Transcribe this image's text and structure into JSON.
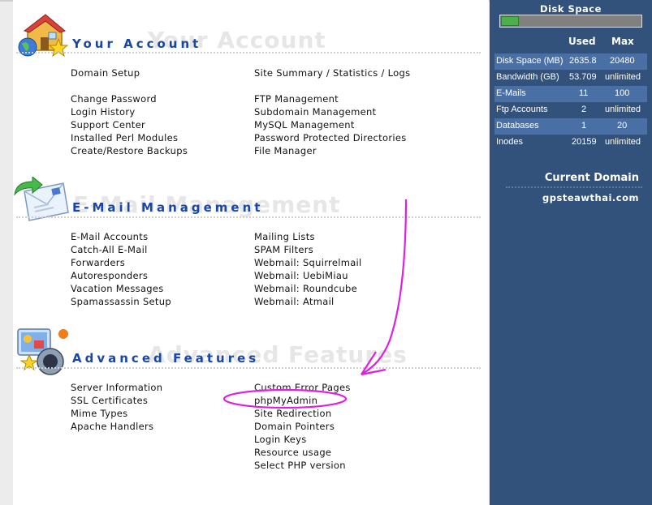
{
  "sections": {
    "account": {
      "title": "Your Account",
      "ghost": "Your Account",
      "left": [
        "Domain Setup",
        "Change Password",
        "Login History",
        "Support Center",
        "Installed Perl Modules",
        "Create/Restore Backups"
      ],
      "right": [
        "Site Summary / Statistics / Logs",
        "FTP Management",
        "Subdomain Management",
        "MySQL Management",
        "Password Protected Directories",
        "File Manager"
      ]
    },
    "email": {
      "title": "E-Mail Management",
      "ghost": "E-Mail Management",
      "left": [
        "E-Mail Accounts",
        "Catch-All E-Mail",
        "Forwarders",
        "Autoresponders",
        "Vacation Messages",
        "Spamassassin Setup"
      ],
      "right": [
        "Mailing Lists",
        "SPAM Filters",
        "Webmail: Squirrelmail",
        "Webmail: UebiMiau",
        "Webmail: Roundcube",
        "Webmail: Atmail"
      ]
    },
    "advanced": {
      "title": "Advanced Features",
      "ghost": "Advanced Features",
      "left": [
        "Server Information",
        "SSL Certificates",
        "Mime Types",
        "Apache Handlers"
      ],
      "right": [
        "Custom Error Pages",
        "phpMyAdmin",
        "Site Redirection",
        "Domain Pointers",
        "Login Keys",
        "Resource usage",
        "Select PHP version"
      ]
    }
  },
  "sidebar": {
    "disk_title": "Disk Space",
    "disk_fraction": 0.129,
    "col_used": "Used",
    "col_max": "Max",
    "rows": [
      {
        "label": "Disk Space (MB)",
        "used": "2635.8",
        "max": "20480"
      },
      {
        "label": "Bandwidth (GB)",
        "used": "53.709",
        "max": "unlimited"
      },
      {
        "label": "E-Mails",
        "used": "11",
        "max": "100"
      },
      {
        "label": "Ftp Accounts",
        "used": "2",
        "max": "unlimited"
      },
      {
        "label": "Databases",
        "used": "1",
        "max": "20"
      },
      {
        "label": "Inodes",
        "used": "20159",
        "max": "unlimited"
      }
    ],
    "current_domain_label": "Current Domain",
    "domain": "gpsteawthai.com"
  },
  "colors": {
    "title_blue": "#1a47a6",
    "sidebar_bg": "#32527c",
    "sidebar_row": "#4a6fa5",
    "annotation": "#e020e0"
  }
}
